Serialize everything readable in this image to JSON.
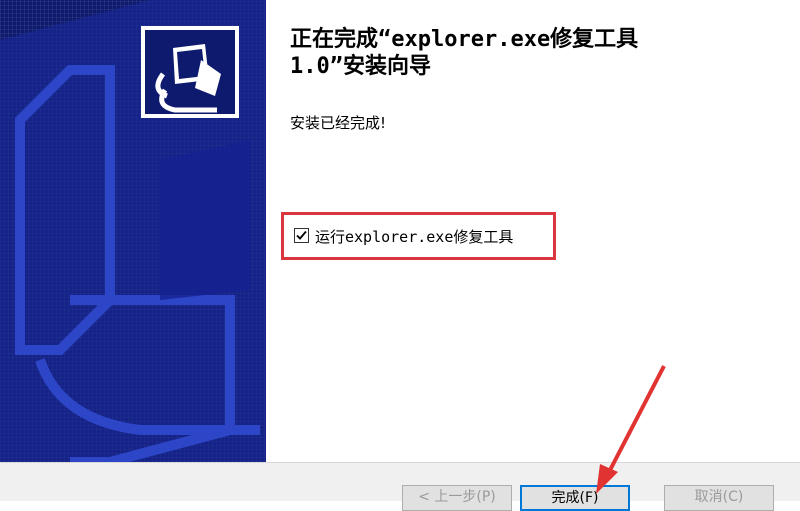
{
  "wizard": {
    "title_line1": "正在完成“explorer.exe修复工具",
    "title_line2": "1.0”安装向导",
    "status_text": "安装已经完成!",
    "run_option": {
      "label": "运行explorer.exe修复工具",
      "checked": true
    }
  },
  "buttons": {
    "back": "< 上一步(P)",
    "finish": "完成(F)",
    "cancel": "取消(C)"
  },
  "icons": {
    "logo": "installer-computer-icon",
    "checkbox": "checkmark-icon",
    "annotation": "red-arrow"
  },
  "colors": {
    "banner": "#0d1a6e",
    "highlight": "#d9363e",
    "focus": "#0078d7"
  }
}
